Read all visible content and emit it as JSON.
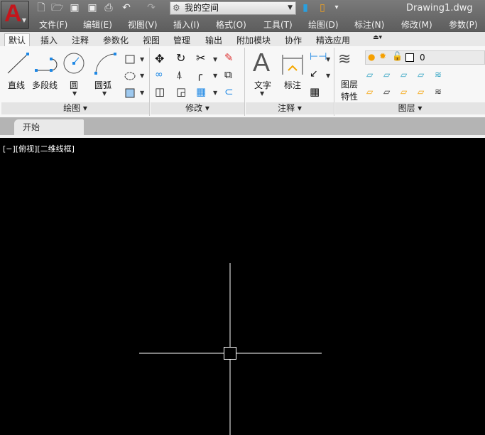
{
  "app": {
    "logo_letter": "A",
    "title": "Drawing1.dwg"
  },
  "quick_access": {
    "workspace": "我的空间",
    "icons": [
      "new-icon",
      "open-icon",
      "save-icon",
      "save-as-icon",
      "plot-icon",
      "undo-icon",
      "redo-icon"
    ]
  },
  "menu": [
    "文件(F)",
    "编辑(E)",
    "视图(V)",
    "插入(I)",
    "格式(O)",
    "工具(T)",
    "绘图(D)",
    "标注(N)",
    "修改(M)",
    "参数(P)"
  ],
  "ribbon_tabs": [
    "默认",
    "插入",
    "注释",
    "参数化",
    "视图",
    "管理",
    "输出",
    "附加模块",
    "协作",
    "精选应用"
  ],
  "panels": {
    "draw": {
      "title": "绘图",
      "tools": [
        "直线",
        "多段线",
        "圆",
        "圆弧"
      ]
    },
    "modify": {
      "title": "修改"
    },
    "annotation": {
      "title": "注释",
      "tools": [
        "文字",
        "标注"
      ]
    },
    "layers": {
      "title": "图层",
      "tool_line1": "图层",
      "tool_line2": "特性",
      "current_layer": "0"
    }
  },
  "file_tab": "开始",
  "viewport_label": "[−][俯视][二维线框]",
  "colors": {
    "accent": "#c4161c",
    "canvas": "#000000",
    "crosshair": "#ffffff"
  }
}
